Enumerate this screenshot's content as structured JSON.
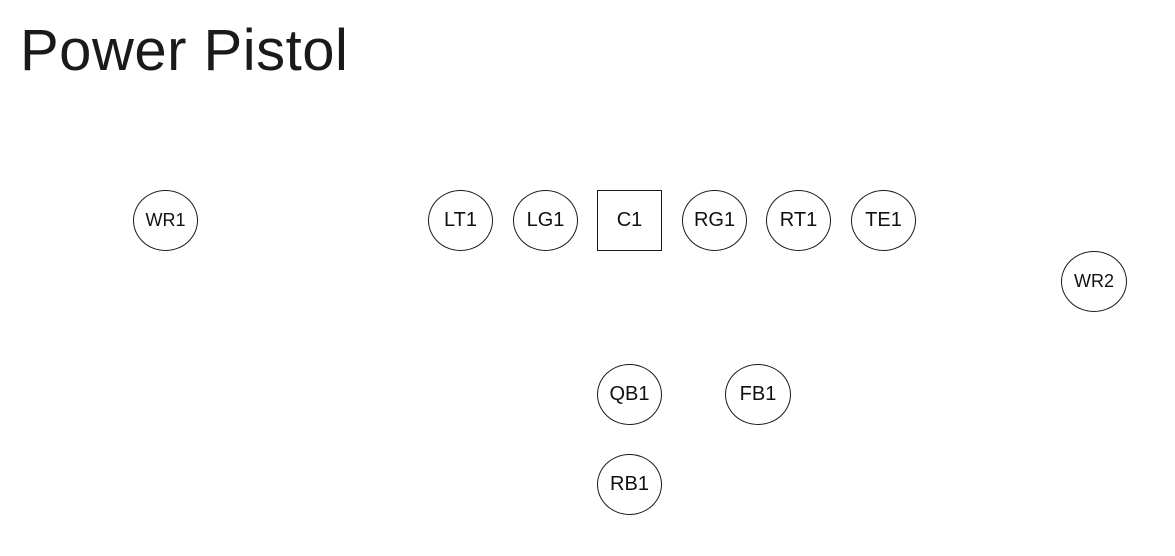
{
  "title": "Power Pistol",
  "players": [
    {
      "id": "wr1",
      "label": "WR1",
      "shape": "circle"
    },
    {
      "id": "lt1",
      "label": "LT1",
      "shape": "circle"
    },
    {
      "id": "lg1",
      "label": "LG1",
      "shape": "circle"
    },
    {
      "id": "c1",
      "label": "C1",
      "shape": "square"
    },
    {
      "id": "rg1",
      "label": "RG1",
      "shape": "circle"
    },
    {
      "id": "rt1",
      "label": "RT1",
      "shape": "circle"
    },
    {
      "id": "te1",
      "label": "TE1",
      "shape": "circle"
    },
    {
      "id": "wr2",
      "label": "WR2",
      "shape": "circle"
    },
    {
      "id": "qb1",
      "label": "QB1",
      "shape": "circle"
    },
    {
      "id": "fb1",
      "label": "FB1",
      "shape": "circle"
    },
    {
      "id": "rb1",
      "label": "RB1",
      "shape": "circle"
    }
  ]
}
